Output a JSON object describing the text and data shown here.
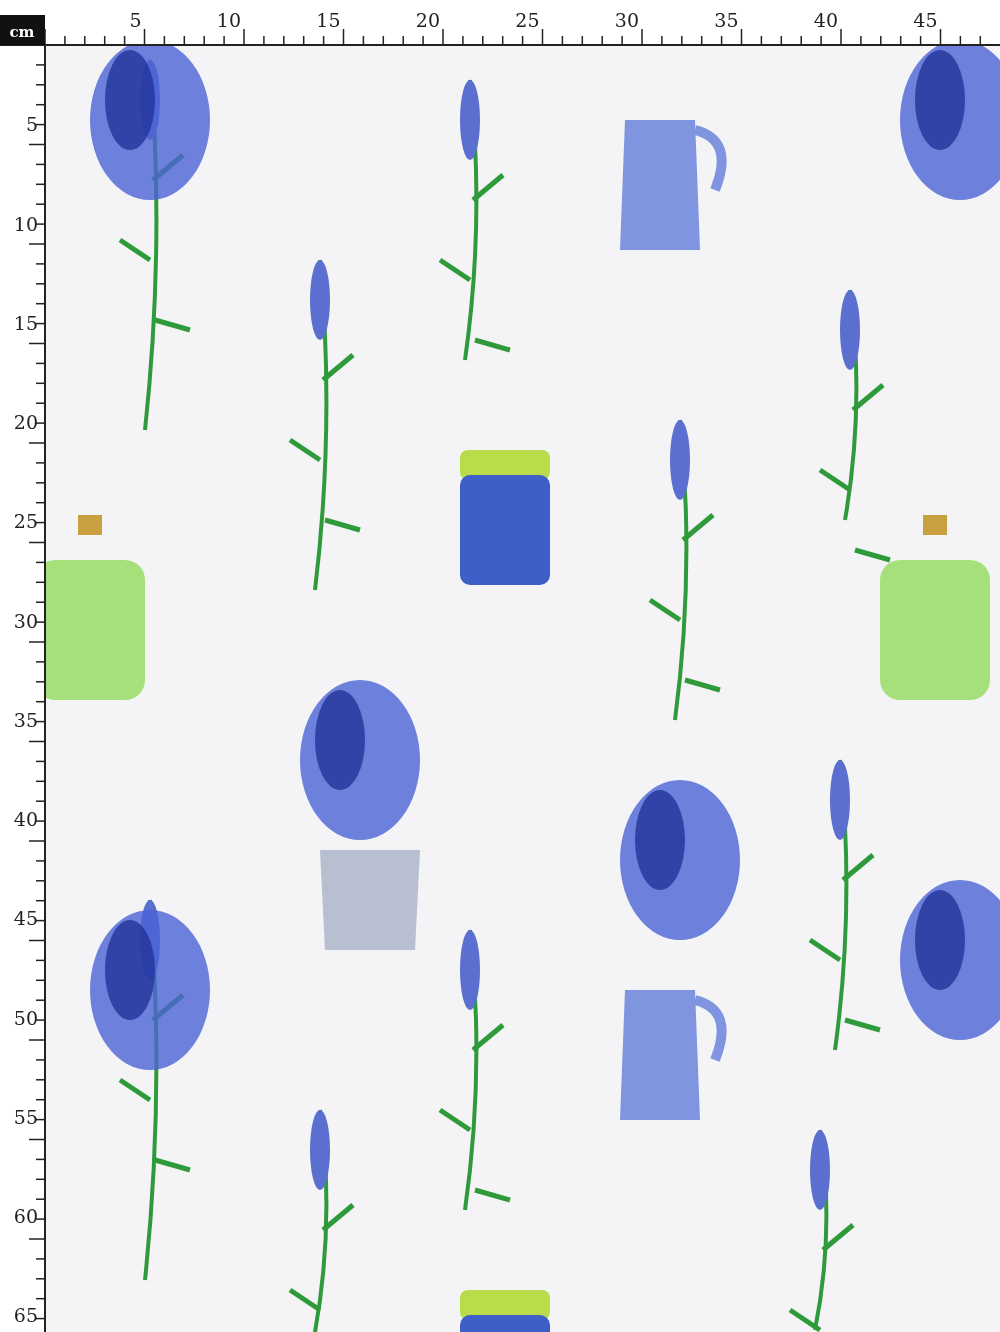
{
  "ruler": {
    "unit": "cm",
    "top_labels": [
      "5",
      "10",
      "15",
      "20",
      "25",
      "30",
      "35",
      "40",
      "45"
    ],
    "left_labels": [
      "5",
      "10",
      "15",
      "20",
      "25",
      "30",
      "35",
      "40",
      "45",
      "50",
      "55",
      "60",
      "65"
    ]
  }
}
